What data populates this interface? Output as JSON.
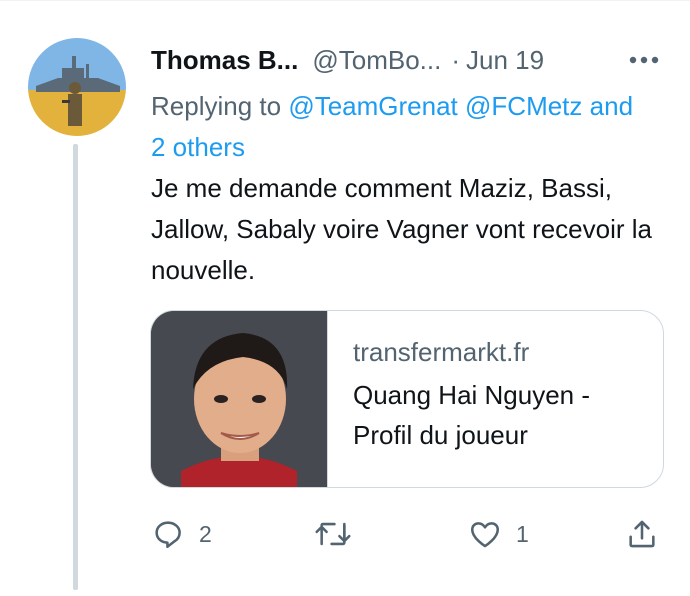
{
  "tweet": {
    "display_name": "Thomas B...",
    "handle": "@TomBo...",
    "separator": "·",
    "time": "Jun 19",
    "replying_to": {
      "prefix": "Replying to",
      "mention1": "@TeamGrenat",
      "mention2": "@FCMetz",
      "others": "and 2 others"
    },
    "text": "Je me demande comment Maziz, Bassi, Jallow, Sabaly voire Vagner vont recevoir la nouvelle.",
    "card": {
      "domain": "transfermarkt.fr",
      "title": "Quang Hai Nguyen - Profil du joueur"
    },
    "actions": {
      "reply_count": "2",
      "like_count": "1"
    }
  },
  "colors": {
    "accent": "#1d9bf0",
    "secondary_text": "#536471",
    "border": "#cfd9de"
  },
  "icons": [
    "more-icon",
    "reply-icon",
    "retweet-icon",
    "like-icon",
    "share-icon"
  ]
}
